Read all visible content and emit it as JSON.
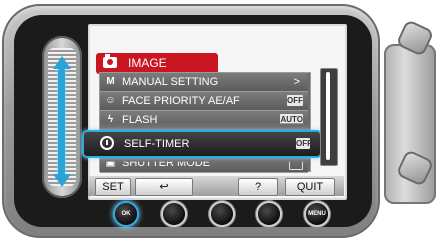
{
  "menu": {
    "title": "IMAGE",
    "items": [
      {
        "label": "MANUAL SETTING",
        "icon": "manual-setting-icon",
        "value": ">"
      },
      {
        "label": "FACE PRIORITY AE/AF",
        "icon": "face-detect-icon",
        "value": "OFF"
      },
      {
        "label": "FLASH",
        "icon": "flash-icon",
        "value": "AUTO"
      },
      {
        "label": "SELF-TIMER",
        "icon": "self-timer-icon",
        "value": "OFF"
      },
      {
        "label": "SHUTTER MODE",
        "icon": "shutter-mode-icon",
        "value": ""
      }
    ],
    "selected_index": 3
  },
  "softkeys": {
    "set": "SET",
    "back": "↩",
    "help": "?",
    "quit": "QUIT"
  },
  "buttons": {
    "ok": "OK",
    "menu": "MENU"
  },
  "colors": {
    "header_red": "#c91620",
    "highlight_blue": "#2fa8e3"
  }
}
